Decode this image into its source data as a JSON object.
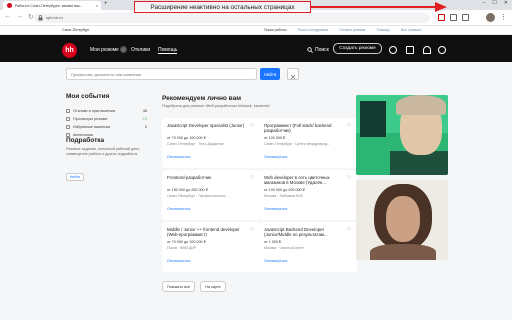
{
  "browser": {
    "tab_title": "Работа в Санкт-Петербурге, свежие вак...",
    "tab_close": "×",
    "new_tab": "+",
    "window_controls": [
      "–",
      "☐",
      "✕"
    ],
    "nav_icons": [
      "←",
      "→",
      "↻"
    ],
    "url": "spb.hh.ru",
    "menu": "⋮"
  },
  "annotation": {
    "text": "Расширение неактивно на остальных страницах",
    "color": "#e02020"
  },
  "utility_bar": {
    "city": "Санкт-Петербург",
    "links": [
      "Поиск работы",
      "Поиск сотрудников",
      "Готовое резюме",
      "Помощь",
      "Все сервисы"
    ]
  },
  "header": {
    "logo": "hh",
    "nav_resumes": "Мои резюме",
    "badge": "0",
    "nav_responses": "Отклики",
    "nav_help": "Помощь",
    "search_label": "Поиск",
    "create_resume": "Создать резюме",
    "brand_color": "#d6001c"
  },
  "search": {
    "placeholder": "Профессия, должность или компания",
    "button": "Найти"
  },
  "sidebar": {
    "events_title": "Мои события",
    "events": [
      {
        "label": "Отклики и приглашения",
        "count": "46",
        "icon": "mail-icon"
      },
      {
        "label": "Просмотры резюме",
        "count": "+1",
        "icon": "eye-icon"
      },
      {
        "label": "Избранные вакансии",
        "count": "0",
        "icon": "star-icon"
      },
      {
        "label": "Автопоиски",
        "count": "",
        "icon": "search-icon"
      }
    ],
    "side_job_title": "Подработка",
    "side_job_desc": "Разовые задания, неполный рабочий день, совмещение работы и других подработок",
    "side_job_button": "Найти"
  },
  "recommendations": {
    "title": "Рекомендуем лично вам",
    "subtitle": "Подобрали для резюме «Веб-разработчик fullstack, backend»",
    "cards": [
      {
        "title": "JavaScript Developer specialist (Junior)",
        "salary": "от 70 000 до 100 000 ₽",
        "company": "Санкт-Петербург · Тело Диджитал",
        "respond": "Откликнуться"
      },
      {
        "title": "Программист (Full stack/ backend разработчик)",
        "salary": "от 100 000 ₽",
        "company": "Санкт-Петербург · Центр международ...",
        "respond": "Откликнуться"
      },
      {
        "title": "Frontend-разработчик",
        "salary": "от 150 000 до 250 000 ₽",
        "company": "Санкт-Петербург · Профессиональ...",
        "respond": "Откликнуться"
      },
      {
        "title": "Web developer в сеть цветочных магазинов в Москве (Удалён...",
        "salary": "от 100 000 до 200 000 ₽",
        "company": "Москва · Любимов М.В.",
        "respond": "Откликнуться"
      },
      {
        "title": "Middle / Junior ++ frontend developer (Web-программист)",
        "salary": "от 70 000 до 100 000 ₽",
        "company": "Псков · ВВМ ДИР",
        "respond": "Откликнуться"
      },
      {
        "title": "JavaScript Backend Developer (Junior/Middle по результатам...",
        "salary": "от 1 000 $",
        "company": "Москва · Частный Агент",
        "respond": "Откликнуться"
      }
    ],
    "show_all": "Показать все",
    "on_map": "На карте"
  },
  "icons": {
    "favorite": "♡",
    "search": "⌕",
    "lock": "lock-icon"
  }
}
